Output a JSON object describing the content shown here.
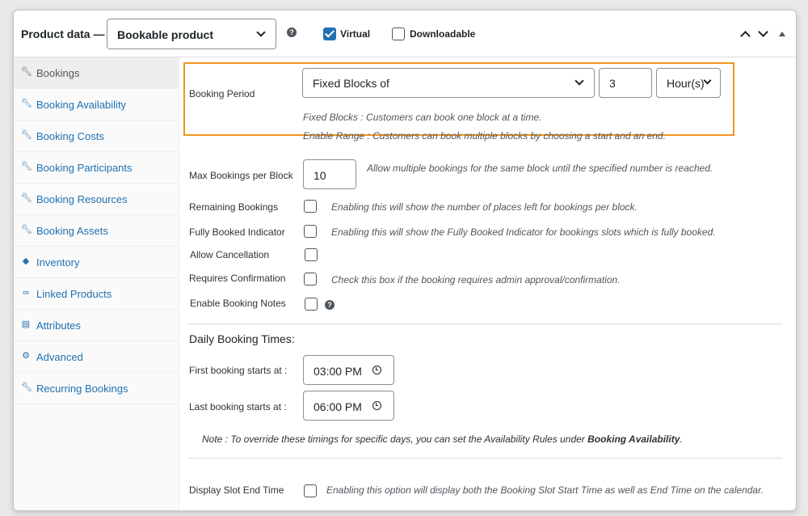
{
  "header": {
    "title": "Product data —",
    "product_type": "Bookable product",
    "virtual_label": "Virtual",
    "virtual_checked": true,
    "downloadable_label": "Downloadable",
    "downloadable_checked": false
  },
  "sidebar": {
    "items": [
      {
        "label": "Bookings",
        "icon": "wrench-icon",
        "active": true
      },
      {
        "label": "Booking Availability",
        "icon": "wrench-icon"
      },
      {
        "label": "Booking Costs",
        "icon": "wrench-icon"
      },
      {
        "label": "Booking Participants",
        "icon": "wrench-icon"
      },
      {
        "label": "Booking Resources",
        "icon": "wrench-icon"
      },
      {
        "label": "Booking Assets",
        "icon": "wrench-icon"
      },
      {
        "label": "Inventory",
        "icon": "tag-icon"
      },
      {
        "label": "Linked Products",
        "icon": "link-icon"
      },
      {
        "label": "Attributes",
        "icon": "list-icon"
      },
      {
        "label": "Advanced",
        "icon": "gear-icon"
      },
      {
        "label": "Recurring Bookings",
        "icon": "wrench-icon"
      }
    ]
  },
  "booking_period": {
    "label": "Booking Period",
    "type_value": "Fixed Blocks of",
    "duration_value": "3",
    "unit_value": "Hour(s)",
    "desc_fixed": "Fixed Blocks : Customers can book one block at a time.",
    "desc_range": "Enable Range : Customers can book multiple blocks by choosing a start and an end."
  },
  "max_bookings": {
    "label": "Max Bookings per Block",
    "value": "10",
    "desc": "Allow multiple bookings for the same block until the specified number is reached."
  },
  "remaining": {
    "label": "Remaining Bookings",
    "desc": "Enabling this will show the number of places left for bookings per block."
  },
  "fully_booked": {
    "label": "Fully Booked Indicator",
    "desc": "Enabling this will show the Fully Booked Indicator for bookings slots which is fully booked."
  },
  "allow_cancel": {
    "label": "Allow Cancellation"
  },
  "requires_confirm": {
    "label": "Requires Confirmation",
    "desc": "Check this box if the booking requires admin approval/confirmation."
  },
  "booking_notes": {
    "label": "Enable Booking Notes"
  },
  "daily_times": {
    "title": "Daily Booking Times:",
    "first_label": "First booking starts at :",
    "first_value": "03:00 PM",
    "last_label": "Last booking starts at :",
    "last_value": "06:00 PM",
    "note_prefix": "Note : To override these timings for specific days, you can set the Availability Rules under ",
    "note_bold": "Booking Availability",
    "note_suffix": "."
  },
  "slot_end": {
    "label": "Display Slot End Time",
    "desc": "Enabling this option will display both the Booking Slot Start Time as well as End Time on the calendar."
  }
}
